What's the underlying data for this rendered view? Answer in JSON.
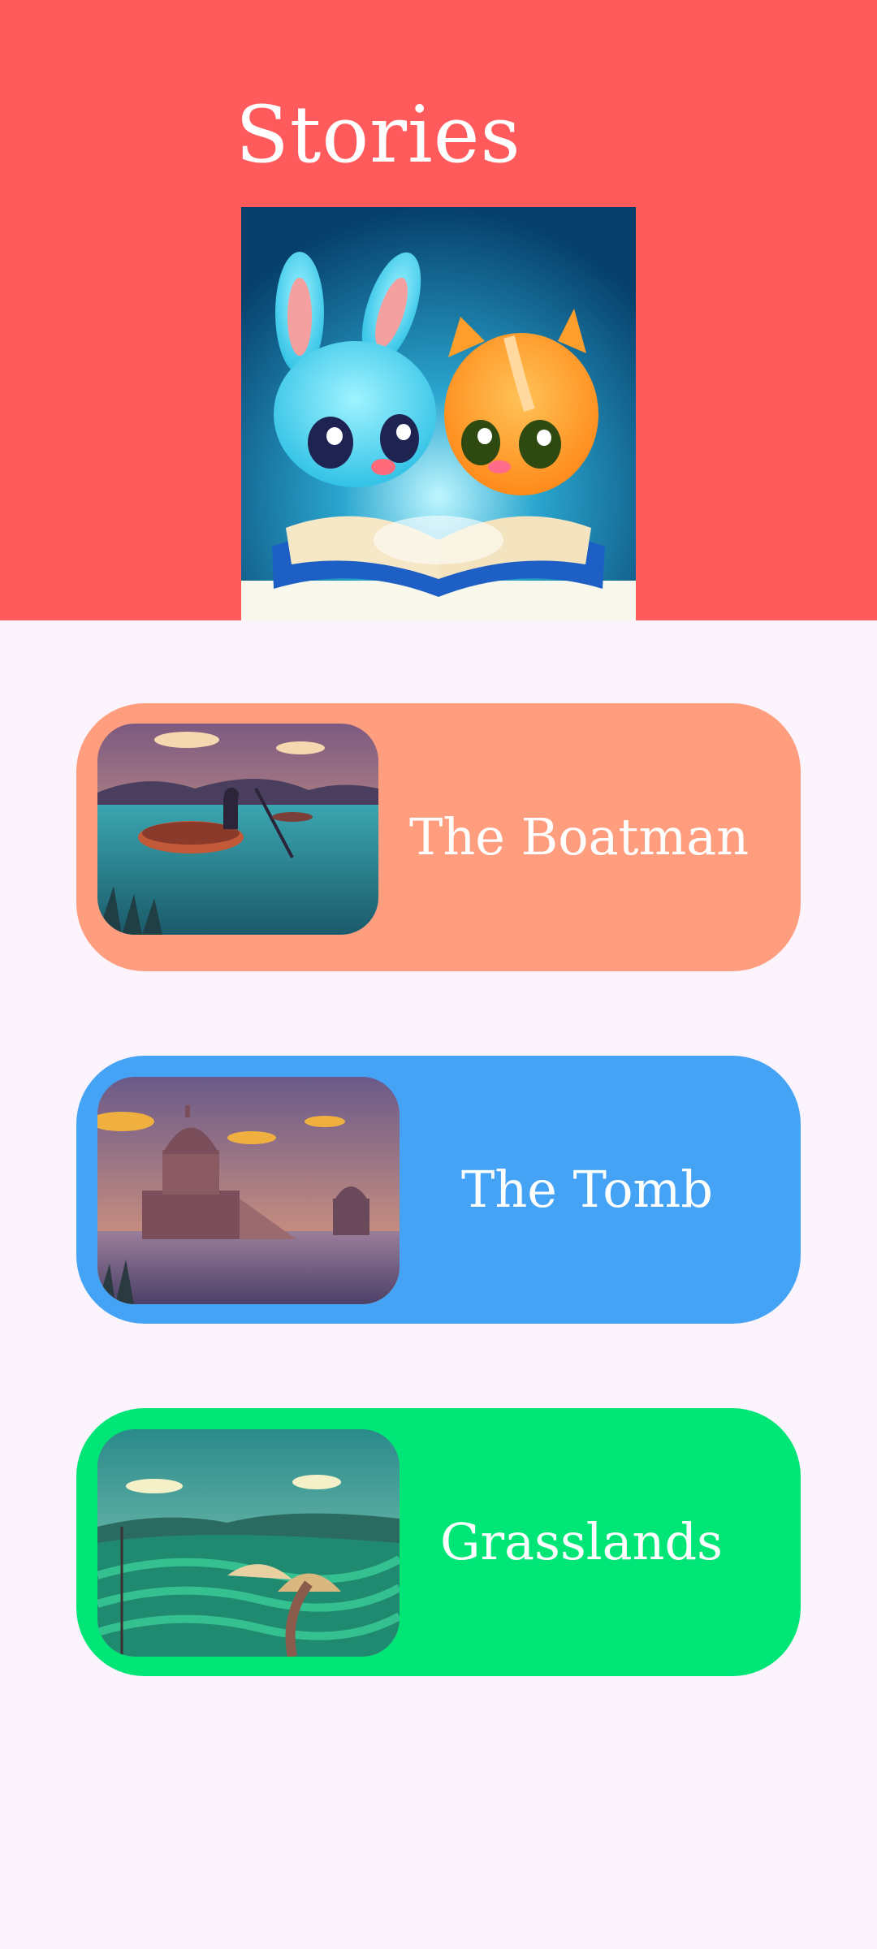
{
  "header": {
    "title": "Stories",
    "background_color": "#ff5a5c",
    "hero_image": "bunny-and-cat-reading-book"
  },
  "stories": [
    {
      "title": "The Boatman",
      "card_color": "#ff9d7f",
      "thumbnail": "boatman-coracle-lake-illustration"
    },
    {
      "title": "The Tomb",
      "card_color": "#45a3f5",
      "thumbnail": "tomb-on-lake-illustration"
    },
    {
      "title": "Grasslands",
      "card_color": "#00e676",
      "thumbnail": "terraced-grasslands-hut-illustration"
    }
  ],
  "page_background_color": "#fcf4fc"
}
